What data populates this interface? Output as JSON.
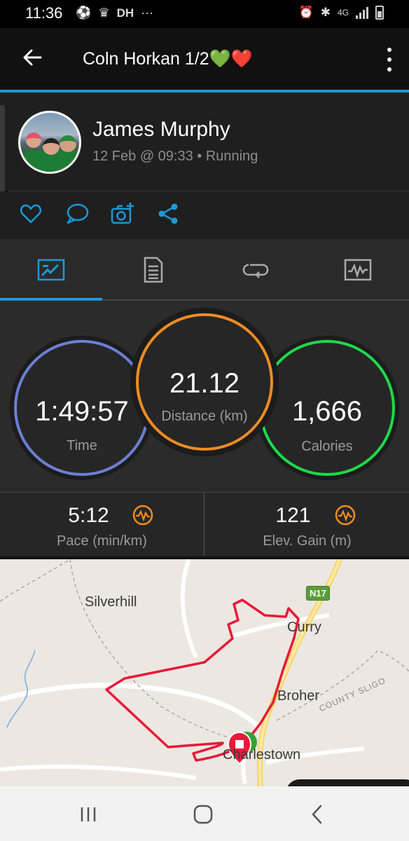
{
  "status_bar": {
    "time": "11:36",
    "left_icons": [
      "soccer-ball-icon",
      "premier-league-icon",
      "dh-icon",
      "more-dots-icon"
    ],
    "dh_text": "DH",
    "dots_text": "···",
    "network": "4G",
    "right_icons": [
      "alarm-icon",
      "bluetooth-icon",
      "network-4g-icon",
      "signal-icon",
      "battery-icon"
    ]
  },
  "header": {
    "title": "Coln Horkan 1/2💚❤️",
    "back_icon": "arrow-left-icon",
    "menu_icon": "more-vertical-icon",
    "accent_color": "#1a9ad6"
  },
  "profile": {
    "name": "James Murphy",
    "meta": "12 Feb @ 09:33 • Running"
  },
  "actions": [
    "heart-icon",
    "comment-icon",
    "add-photo-icon",
    "share-icon"
  ],
  "tabs": [
    {
      "icon": "stats-icon",
      "active": true
    },
    {
      "icon": "details-icon",
      "active": false
    },
    {
      "icon": "laps-icon",
      "active": false
    },
    {
      "icon": "charts-icon",
      "active": false
    }
  ],
  "stats": {
    "time": {
      "value": "1:49:57",
      "label": "Time",
      "color": "#6b7fd4"
    },
    "distance": {
      "value": "21.12",
      "label": "Distance (km)",
      "color": "#ef8c23"
    },
    "calories": {
      "value": "1,666",
      "label": "Calories",
      "color": "#1fd84a"
    }
  },
  "metrics": {
    "pace": {
      "value": "5:12",
      "label": "Pace (min/km)",
      "icon": "pace-chart-icon"
    },
    "elev": {
      "value": "121",
      "label": "Elev. Gain (m)",
      "icon": "elevation-chart-icon"
    }
  },
  "map": {
    "labels": {
      "silverhill": "Silverhill",
      "curry": "Curry",
      "broher": "Broher",
      "town": "Charlestown",
      "county": "COUNTY SLIGO",
      "road": "N17"
    },
    "route_color": "#e8193a"
  },
  "navbar": [
    "recent-apps-icon",
    "home-icon",
    "back-icon"
  ]
}
